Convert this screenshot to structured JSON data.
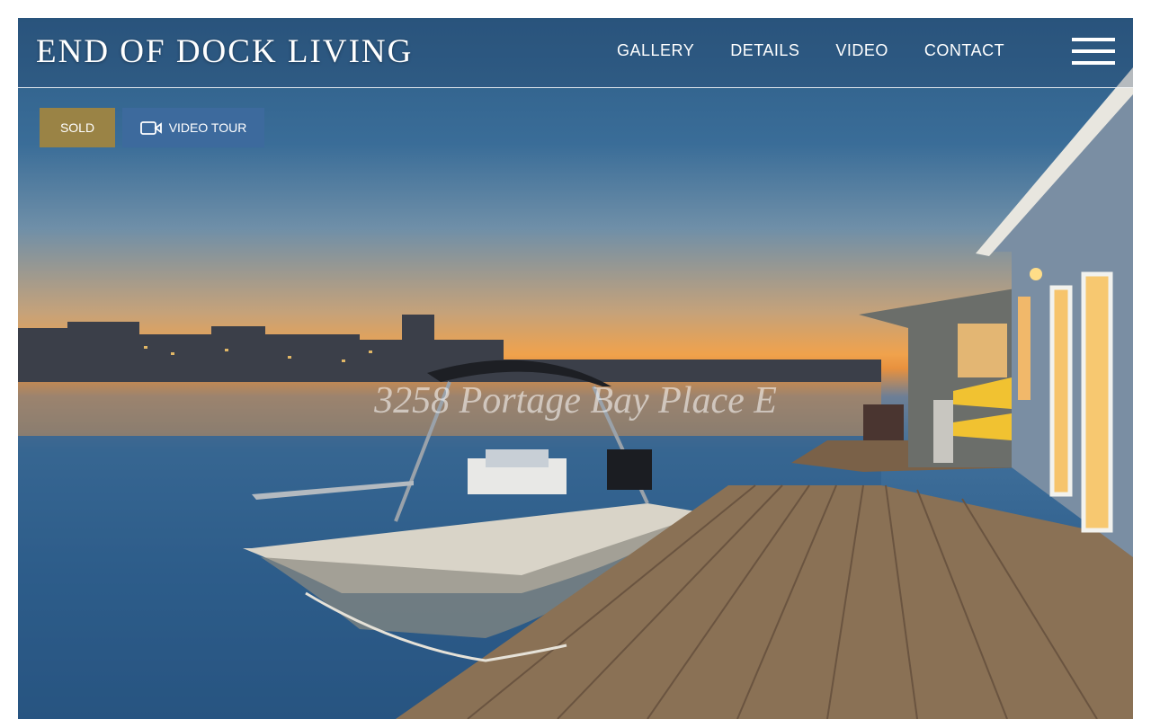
{
  "header": {
    "logo": "END OF DOCK LIVING",
    "nav": [
      {
        "label": "GALLERY"
      },
      {
        "label": "DETAILS"
      },
      {
        "label": "VIDEO"
      },
      {
        "label": "CONTACT"
      }
    ],
    "menu_icon": "hamburger-menu-icon"
  },
  "badges": {
    "status": "SOLD",
    "video_tour": "VIDEO TOUR",
    "video_icon": "video-camera-icon"
  },
  "hero": {
    "address": "3258 Portage Bay Place E",
    "image": "dock-boat-sunset-photo"
  },
  "colors": {
    "sold_badge": "#9a8345",
    "video_badge": "#3d6a9d",
    "text": "#ffffff"
  }
}
